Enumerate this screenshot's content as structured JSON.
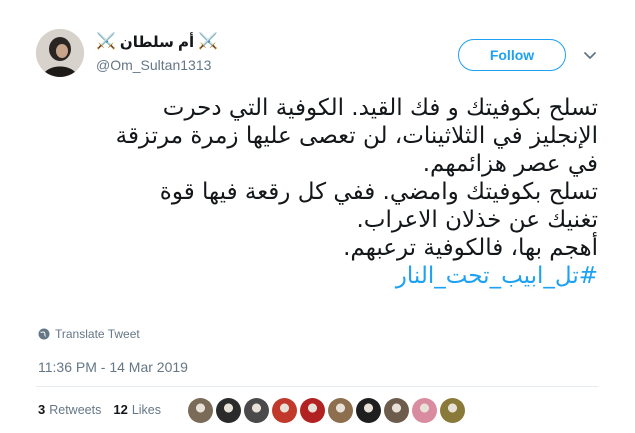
{
  "author": {
    "display_name": "أم سلطان",
    "emoji_left": "⚔️",
    "emoji_right": "⚔️",
    "handle": "@Om_Sultan1313",
    "avatar_icon": "profile-photo"
  },
  "follow_button": {
    "label": "Follow"
  },
  "menu": {
    "icon": "chevron-down-icon"
  },
  "tweet": {
    "lines": [
      "تسلح بكوفيتك و فك القيد. الكوفية التي دحرت",
      "الإنجليز في الثلاثينات، لن تعصى عليها زمرة مرتزقة",
      "في عصر هزائمهم.",
      "تسلح بكوفيتك وامضي. ففي كل رقعة فيها قوة",
      "تغنيك عن خذلان الاعراب.",
      "أهجم بها، فالكوفية ترعبهم."
    ],
    "hashtag": "#تل_ابيب_تحت_النار"
  },
  "translate": {
    "label": "Translate Tweet",
    "icon": "globe-icon"
  },
  "timestamp": "11:36 PM - 14 Mar 2019",
  "stats": {
    "retweets_count": "3",
    "retweets_label": "Retweets",
    "likes_count": "12",
    "likes_label": "Likes"
  },
  "likers": [
    {
      "name": "liker-1",
      "color": "#7a6a58"
    },
    {
      "name": "liker-2",
      "color": "#2b2b2b"
    },
    {
      "name": "liker-3",
      "color": "#4a4a4a"
    },
    {
      "name": "liker-4",
      "color": "#c0392b"
    },
    {
      "name": "liker-5",
      "color": "#b22222"
    },
    {
      "name": "liker-6",
      "color": "#8d6e4f"
    },
    {
      "name": "liker-7",
      "color": "#1f1f1f"
    },
    {
      "name": "liker-8",
      "color": "#6d5c4b"
    },
    {
      "name": "liker-9",
      "color": "#d98ba0"
    },
    {
      "name": "liker-10",
      "color": "#8a7a3a"
    }
  ],
  "colors": {
    "accent": "#1da1f2",
    "muted": "#657786",
    "text": "#14171a"
  }
}
